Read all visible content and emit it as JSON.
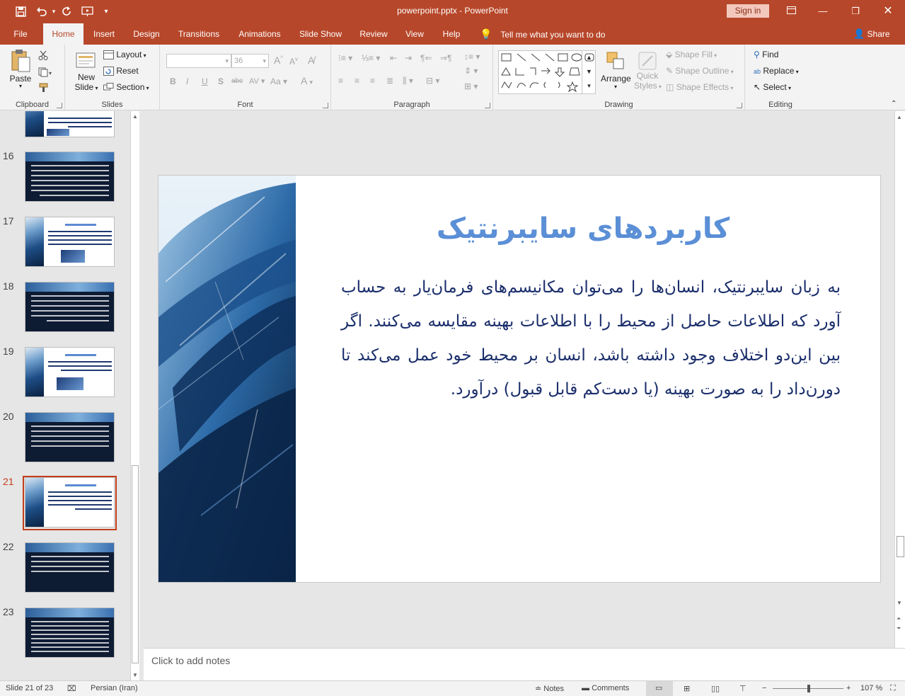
{
  "window": {
    "title": "powerpoint.pptx  -  PowerPoint",
    "sign_in": "Sign in"
  },
  "tabs": [
    "File",
    "Home",
    "Insert",
    "Design",
    "Transitions",
    "Animations",
    "Slide Show",
    "Review",
    "View",
    "Help"
  ],
  "tell_me": "Tell me what you want to do",
  "share": "Share",
  "ribbon": {
    "clipboard": {
      "label": "Clipboard",
      "paste": "Paste"
    },
    "slides": {
      "label": "Slides",
      "new_slide_1": "New",
      "new_slide_2": "Slide",
      "layout": "Layout",
      "reset": "Reset",
      "section": "Section"
    },
    "font": {
      "label": "Font",
      "font_name": "",
      "font_size": "36"
    },
    "paragraph": {
      "label": "Paragraph"
    },
    "drawing": {
      "label": "Drawing",
      "arrange": "Arrange",
      "quick_styles_1": "Quick",
      "quick_styles_2": "Styles",
      "shape_fill": "Shape Fill",
      "shape_outline": "Shape Outline",
      "shape_effects": "Shape Effects"
    },
    "editing": {
      "label": "Editing",
      "find": "Find",
      "replace": "Replace",
      "select": "Select"
    }
  },
  "thumbnails": {
    "numbers": [
      "16",
      "17",
      "18",
      "19",
      "20",
      "21",
      "22",
      "23"
    ],
    "selected": "21"
  },
  "slide": {
    "title": "کاربردهای سایبرنتیک",
    "body": "به زبان سایبرنتیک، انسان‌ها را می‌توان مکانیسم‌های فرمان‌یار به حساب آورد که اطلاعات حاصل از محیط را با اطلاعات بهینه مقایسه می‌کنند. اگر بین این‌دو اختلاف وجود داشته باشد، انسان بر محیط خود عمل می‌کند تا دورن‌داد را به صورت بهینه (یا دست‌کم قابل قبول) درآورد."
  },
  "notes": {
    "placeholder": "Click to add notes"
  },
  "status": {
    "slide_info": "Slide 21 of 23",
    "language": "Persian (Iran)",
    "notes": "Notes",
    "comments": "Comments",
    "zoom": "107 %"
  },
  "colors": {
    "accent": "#b7472a",
    "selected_thumb": "#c43e1c",
    "title_blue": "#5b8fd6",
    "body_navy": "#1a2e6b"
  }
}
